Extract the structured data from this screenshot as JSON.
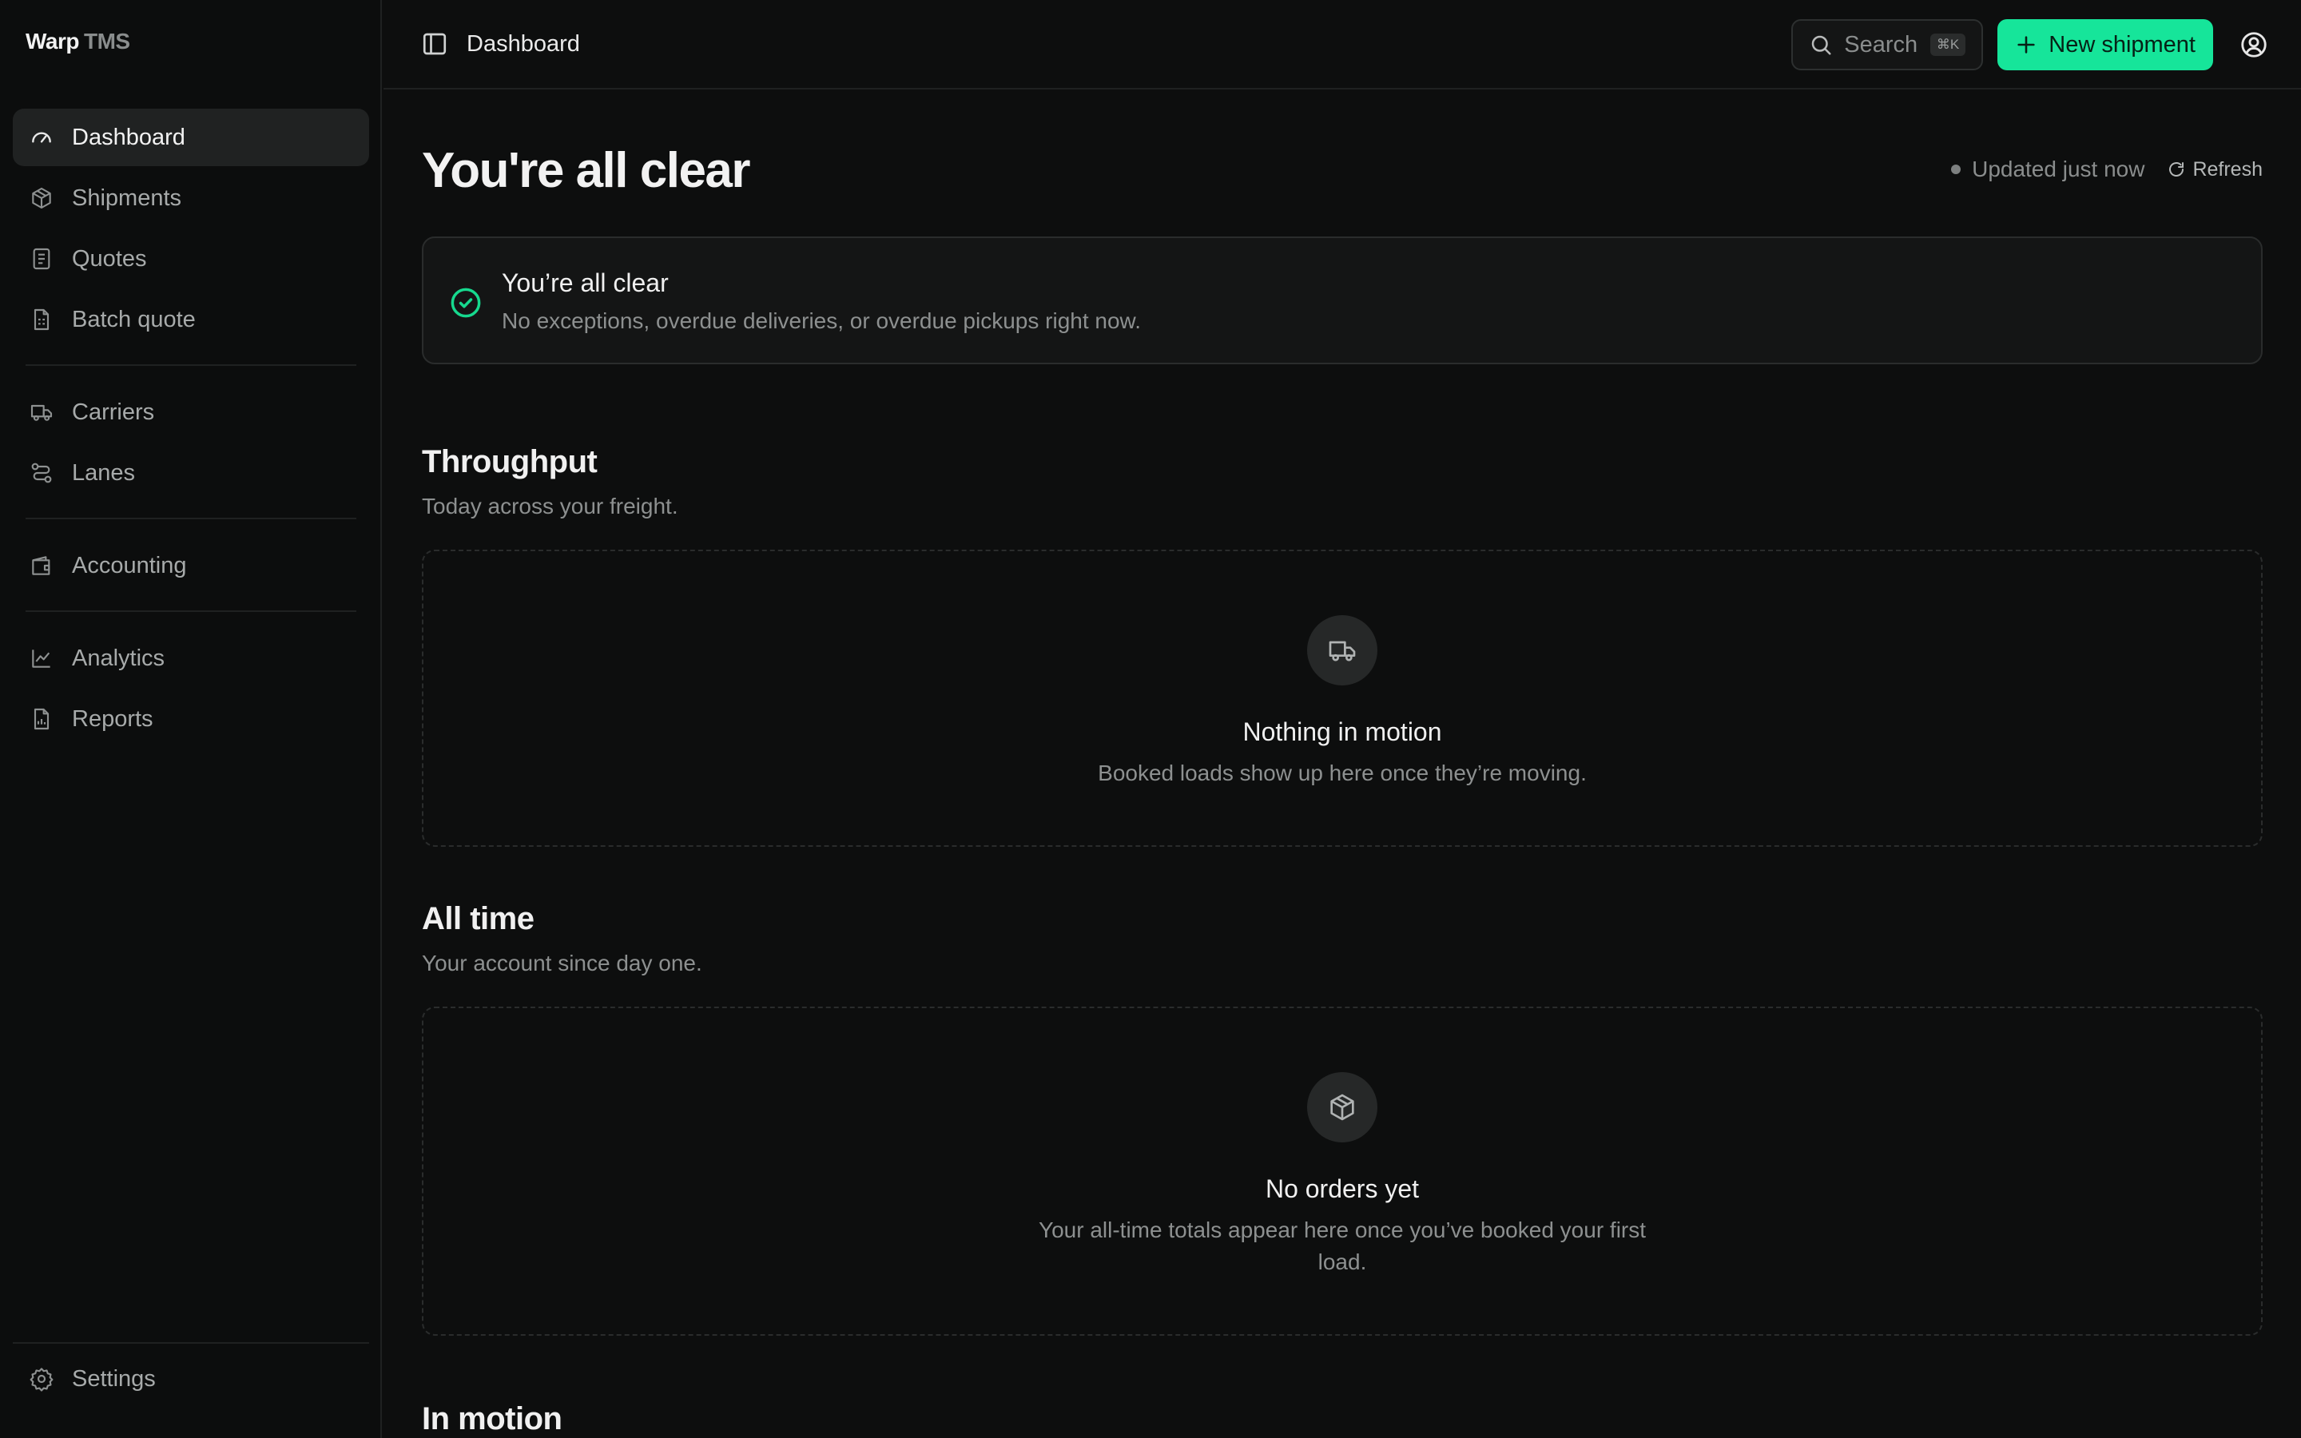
{
  "brand": {
    "name": "Warp",
    "suffix": "TMS"
  },
  "sidebar": {
    "items": [
      {
        "label": "Dashboard",
        "icon": "gauge-icon",
        "active": true
      },
      {
        "label": "Shipments",
        "icon": "package-icon"
      },
      {
        "label": "Quotes",
        "icon": "receipt-icon"
      },
      {
        "label": "Batch quote",
        "icon": "document-spreadsheet-icon"
      },
      {
        "label": "Carriers",
        "icon": "truck-icon"
      },
      {
        "label": "Lanes",
        "icon": "route-icon"
      },
      {
        "label": "Accounting",
        "icon": "wallet-icon"
      },
      {
        "label": "Analytics",
        "icon": "chart-line-icon"
      },
      {
        "label": "Reports",
        "icon": "report-icon"
      }
    ],
    "settings": {
      "label": "Settings",
      "icon": "gear-icon"
    }
  },
  "topbar": {
    "breadcrumb": "Dashboard",
    "search_label": "Search",
    "search_shortcut": "⌘K",
    "new_button": "New shipment"
  },
  "main": {
    "title": "You're all clear",
    "updated": "Updated just now",
    "refresh": "Refresh",
    "alert": {
      "title": "You’re all clear",
      "subtitle": "No exceptions, overdue deliveries, or overdue pickups right now."
    },
    "throughput": {
      "title": "Throughput",
      "subtitle": "Today across your freight.",
      "empty_title": "Nothing in motion",
      "empty_subtitle": "Booked loads show up here once they’re moving."
    },
    "all_time": {
      "title": "All time",
      "subtitle": "Your account since day one.",
      "empty_title": "No orders yet",
      "empty_subtitle": "Your all-time totals appear here once you’ve booked your first load."
    },
    "in_motion": {
      "title": "In motion"
    }
  },
  "colors": {
    "accent": "#16e59a",
    "background": "#0d0e0e",
    "success": "#16d98e"
  }
}
